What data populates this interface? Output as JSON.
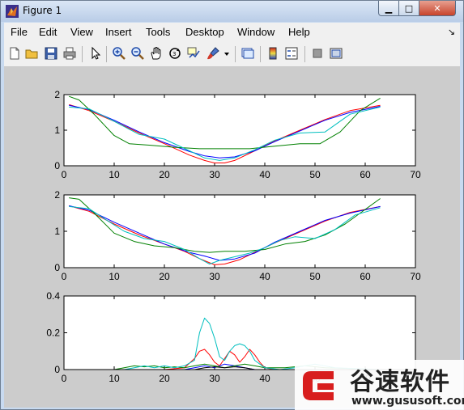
{
  "window": {
    "title": "Figure 1",
    "minimize_glyph": "▁",
    "maximize_glyph": "□",
    "close_glyph": "✕"
  },
  "menu": {
    "items": [
      "File",
      "Edit",
      "View",
      "Insert",
      "Tools",
      "Desktop",
      "Window",
      "Help"
    ],
    "overflow_glyph": "↘"
  },
  "toolbar": {
    "icons": [
      "new-figure-icon",
      "open-file-icon",
      "save-icon",
      "print-icon",
      "edit-plot-arrow-icon",
      "zoom-in-icon",
      "zoom-out-icon",
      "pan-hand-icon",
      "rotate-3d-icon",
      "data-cursor-icon",
      "brush-icon",
      "brush-dropdown-icon",
      "link-plot-icon",
      "insert-colorbar-icon",
      "insert-legend-icon",
      "hide-plot-tools-icon",
      "show-plot-tools-icon"
    ]
  },
  "colors": {
    "red": "#ff0000",
    "blue": "#0000ff",
    "green": "#008000",
    "cyan": "#00bfbf",
    "black": "#000000"
  },
  "chart_data": [
    {
      "type": "line",
      "xlim": [
        0,
        70
      ],
      "ylim": [
        0,
        2
      ],
      "xticks": [
        "0",
        "10",
        "20",
        "30",
        "40",
        "50",
        "60",
        "70"
      ],
      "yticks": [
        "0",
        "1",
        "2"
      ],
      "series": [
        {
          "color": "#ff0000",
          "x": [
            1,
            5,
            10,
            15,
            20,
            25,
            28,
            30,
            32,
            34,
            38,
            42,
            47,
            52,
            57,
            63
          ],
          "y": [
            1.72,
            1.55,
            1.25,
            0.92,
            0.62,
            0.3,
            0.15,
            0.08,
            0.08,
            0.15,
            0.42,
            0.7,
            1.0,
            1.3,
            1.55,
            1.7
          ]
        },
        {
          "color": "#0000ff",
          "x": [
            1,
            5,
            10,
            15,
            20,
            25,
            28,
            31,
            34,
            38,
            42,
            47,
            52,
            57,
            63
          ],
          "y": [
            1.7,
            1.58,
            1.28,
            0.95,
            0.65,
            0.4,
            0.28,
            0.22,
            0.25,
            0.42,
            0.68,
            0.98,
            1.28,
            1.5,
            1.67
          ]
        },
        {
          "color": "#008000",
          "x": [
            1,
            3,
            6,
            10,
            13,
            17,
            22,
            27,
            32,
            37,
            42,
            47,
            51,
            55,
            59,
            63
          ],
          "y": [
            1.95,
            1.85,
            1.45,
            0.85,
            0.62,
            0.58,
            0.52,
            0.48,
            0.48,
            0.48,
            0.55,
            0.62,
            0.62,
            0.95,
            1.55,
            1.9
          ]
        },
        {
          "color": "#00bfbf",
          "x": [
            1,
            5,
            10,
            15,
            20,
            25,
            28,
            31,
            34,
            38,
            42,
            47,
            52,
            57,
            63
          ],
          "y": [
            1.65,
            1.6,
            1.25,
            0.88,
            0.75,
            0.42,
            0.22,
            0.15,
            0.22,
            0.45,
            0.72,
            0.92,
            0.95,
            1.45,
            1.65
          ]
        }
      ]
    },
    {
      "type": "line",
      "xlim": [
        0,
        70
      ],
      "ylim": [
        0,
        2
      ],
      "xticks": [
        "0",
        "10",
        "20",
        "30",
        "40",
        "50",
        "60",
        "70"
      ],
      "yticks": [
        "0",
        "1",
        "2"
      ],
      "series": [
        {
          "color": "#ff0000",
          "x": [
            1,
            5,
            10,
            15,
            20,
            24,
            27,
            30,
            32,
            35,
            38,
            42,
            47,
            52,
            57,
            63
          ],
          "y": [
            1.7,
            1.55,
            1.2,
            0.9,
            0.65,
            0.45,
            0.25,
            0.08,
            0.1,
            0.22,
            0.42,
            0.68,
            0.98,
            1.28,
            1.52,
            1.68
          ]
        },
        {
          "color": "#0000ff",
          "x": [
            1,
            5,
            10,
            15,
            20,
            25,
            28,
            31,
            34,
            38,
            42,
            47,
            52,
            57,
            63
          ],
          "y": [
            1.7,
            1.58,
            1.25,
            0.95,
            0.65,
            0.42,
            0.32,
            0.2,
            0.24,
            0.4,
            0.7,
            1.0,
            1.3,
            1.5,
            1.68
          ]
        },
        {
          "color": "#008000",
          "x": [
            1,
            3,
            6,
            10,
            14,
            18,
            22,
            26,
            29,
            32,
            36,
            40,
            44,
            48,
            52,
            56,
            60,
            63
          ],
          "y": [
            1.92,
            1.88,
            1.5,
            0.95,
            0.72,
            0.6,
            0.55,
            0.45,
            0.42,
            0.45,
            0.45,
            0.5,
            0.65,
            0.72,
            0.9,
            1.2,
            1.6,
            1.9
          ]
        },
        {
          "color": "#00bfbf",
          "x": [
            1,
            5,
            8,
            12,
            16,
            20,
            24,
            27,
            29,
            31,
            34,
            37,
            40,
            43,
            46,
            50,
            54,
            58,
            63
          ],
          "y": [
            1.68,
            1.62,
            1.35,
            1.0,
            0.8,
            0.72,
            0.5,
            0.25,
            0.1,
            0.2,
            0.3,
            0.4,
            0.55,
            0.75,
            0.85,
            0.8,
            1.05,
            1.45,
            1.65
          ]
        }
      ]
    },
    {
      "type": "line",
      "xlim": [
        0,
        70
      ],
      "ylim": [
        0,
        0.4
      ],
      "xticks": [
        "0",
        "10",
        "20",
        "30",
        "40",
        "50",
        "60",
        "70"
      ],
      "yticks": [
        "0",
        "0.2",
        "0.4"
      ],
      "series": [
        {
          "color": "#ff0000",
          "x": [
            1,
            20,
            24,
            26,
            27,
            28,
            29,
            30,
            31,
            32,
            33,
            34,
            35,
            36,
            37,
            38,
            39,
            40,
            42,
            63
          ],
          "y": [
            0,
            0,
            0.01,
            0.06,
            0.1,
            0.11,
            0.08,
            0.04,
            0.02,
            0.06,
            0.1,
            0.08,
            0.04,
            0.07,
            0.11,
            0.08,
            0.04,
            0.01,
            0,
            0
          ]
        },
        {
          "color": "#0000ff",
          "x": [
            1,
            24,
            26,
            28,
            30,
            32,
            34,
            36,
            38,
            63
          ],
          "y": [
            0,
            0,
            0.01,
            0.02,
            0.01,
            0.03,
            0.02,
            0.01,
            0,
            0
          ]
        },
        {
          "color": "#008000",
          "x": [
            1,
            10,
            12,
            14,
            16,
            18,
            20,
            22,
            24,
            26,
            28,
            30,
            32,
            34,
            36,
            38,
            40,
            44,
            48,
            52,
            63
          ],
          "y": [
            0,
            0,
            0.01,
            0.02,
            0.015,
            0.02,
            0.01,
            0.015,
            0.01,
            0.02,
            0.03,
            0.02,
            0.01,
            0.02,
            0.03,
            0.02,
            0.01,
            0.01,
            0.02,
            0.01,
            0
          ]
        },
        {
          "color": "#00bfbf",
          "x": [
            1,
            12,
            14,
            16,
            18,
            20,
            22,
            24,
            26,
            27,
            28,
            29,
            30,
            31,
            32,
            33,
            34,
            35,
            36,
            37,
            38,
            40,
            43,
            46,
            48,
            50,
            54,
            63
          ],
          "y": [
            0,
            0,
            0.01,
            0.02,
            0.01,
            0.02,
            0.01,
            0.02,
            0.05,
            0.2,
            0.28,
            0.25,
            0.17,
            0.07,
            0.05,
            0.1,
            0.13,
            0.14,
            0.13,
            0.1,
            0.05,
            0.01,
            0,
            0.01,
            0.02,
            0.03,
            0.01,
            0
          ]
        },
        {
          "color": "#000000",
          "x": [
            1,
            26,
            28,
            30,
            32,
            34,
            36,
            38,
            63
          ],
          "y": [
            0,
            0,
            0.01,
            0.015,
            0.01,
            0.015,
            0.01,
            0,
            0
          ]
        }
      ]
    }
  ],
  "watermark": {
    "name": "谷速软件",
    "url": "www.gususoft.com"
  }
}
